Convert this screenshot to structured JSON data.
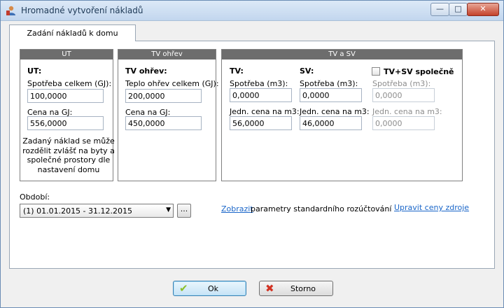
{
  "window": {
    "title": "Hromadné vytvoření nákladů",
    "minimize": "—",
    "maximize": "□",
    "close": "✕"
  },
  "tab": {
    "label": "Zadání nákladů k domu"
  },
  "ut": {
    "header": "UT",
    "title": "UT:",
    "consumption_label": "Spotřeba celkem (GJ):",
    "consumption_value": "100,0000",
    "price_label": "Cena na GJ:",
    "price_value": "556,0000",
    "note": "Zadaný náklad se může rozdělit zvlášť na byty a společné prostory dle nastavení domu"
  },
  "tv_heat": {
    "header": "TV ohřev",
    "title": "TV ohřev:",
    "heat_label": "Teplo ohřev celkem (GJ):",
    "heat_value": "200,0000",
    "price_label": "Cena na GJ:",
    "price_value": "450,0000"
  },
  "tv_sv": {
    "header": "TV a SV",
    "tv": {
      "title": "TV:",
      "consumption_label": "Spotřeba (m3):",
      "consumption_value": "0,0000",
      "price_label": "Jedn. cena na m3:",
      "price_value": "56,0000"
    },
    "sv": {
      "title": "SV:",
      "consumption_label": "Spotřeba (m3):",
      "consumption_value": "0,0000",
      "price_label": "Jedn. cena na m3:",
      "price_value": "46,0000"
    },
    "combined": {
      "checkbox_label": "TV+SV společně",
      "checked": false,
      "consumption_label": "Spotřeba (m3):",
      "consumption_value": "0,0000",
      "price_label": "Jedn. cena na m3:",
      "price_value": "0,0000"
    }
  },
  "period": {
    "label": "Období:",
    "selected": "(1) 01.01.2015 - 31.12.2015",
    "browse": "..."
  },
  "links": {
    "show": "Zobrazit",
    "show_suffix": "parametry standardního rozúčtování",
    "edit_prices": "Upravit ceny zdroje"
  },
  "buttons": {
    "ok": "Ok",
    "cancel": "Storno"
  },
  "icons": {
    "ok": "check-icon",
    "cancel": "x-icon",
    "app": "user-icon"
  }
}
